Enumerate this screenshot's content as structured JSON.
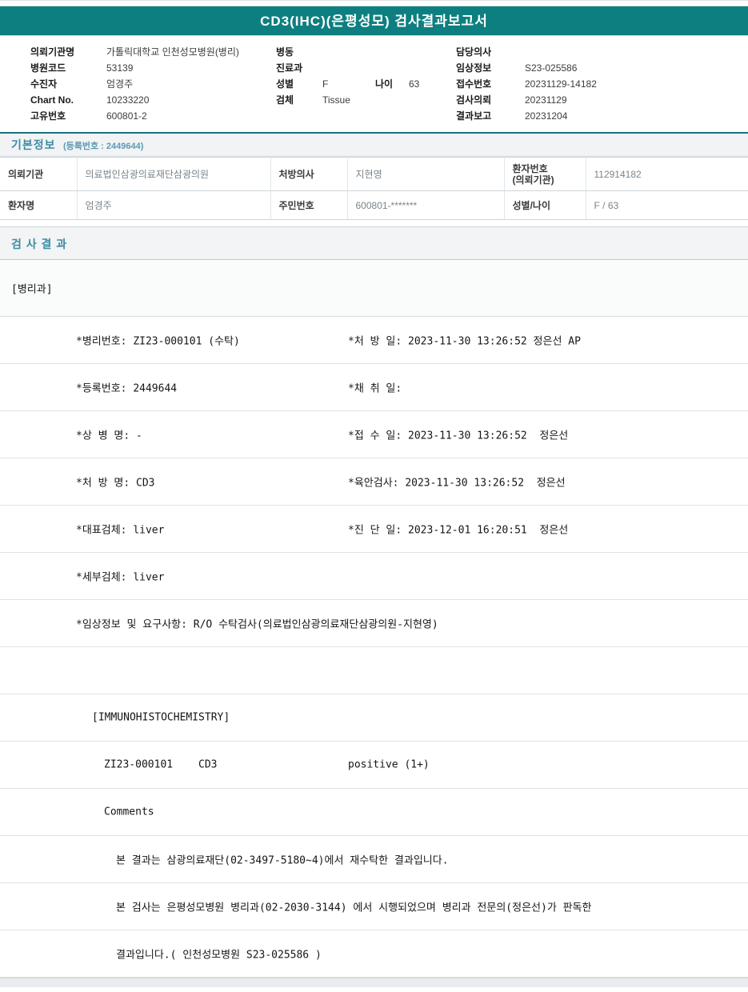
{
  "title": "CD3(IHC)(은평성모) 검사결과보고서",
  "header": {
    "left": [
      {
        "label": "의뢰기관명",
        "value": "가톨릭대학교 인천성모병원(병리)"
      },
      {
        "label": "병원코드",
        "value": "53139"
      },
      {
        "label": "수진자",
        "value": "엄경주"
      },
      {
        "label": "Chart No.",
        "value": "10233220"
      },
      {
        "label": "고유번호",
        "value": "600801-2"
      }
    ],
    "middle": {
      "ward_label": "병동",
      "dept_label": "진료과",
      "sex_label": "성별",
      "sex_value": "F",
      "age_label": "나이",
      "age_value": "63",
      "specimen_label": "검체",
      "specimen_value": "Tissue"
    },
    "right": [
      {
        "label": "담당의사",
        "value": ""
      },
      {
        "label": "임상정보",
        "value": "S23-025586"
      },
      {
        "label": "접수번호",
        "value": "20231129-14182"
      },
      {
        "label": "검사의뢰",
        "value": "20231129"
      },
      {
        "label": "결과보고",
        "value": "20231204"
      }
    ]
  },
  "basic_info": {
    "section_title": "기본정보",
    "section_sub": "(등록번호 : 2449644)",
    "rows": [
      [
        {
          "label": "의뢰기관",
          "value": "의료법인삼광의료재단삼광의원"
        },
        {
          "label": "처방의사",
          "value": "지현영"
        },
        {
          "label": "환자번호\n(의뢰기관)",
          "value": "112914182"
        }
      ],
      [
        {
          "label": "환자명",
          "value": "엄경주"
        },
        {
          "label": "주민번호",
          "value": "600801-*******"
        },
        {
          "label": "성별/나이",
          "value": "F / 63"
        }
      ]
    ]
  },
  "results": {
    "section_title": "검 사 결 과",
    "dept": "[병리과]",
    "detail_rows": [
      {
        "left": "*병리번호: ZI23-000101 (수탁)",
        "right": "*처 방 일: 2023-11-30 13:26:52 정은선 AP"
      },
      {
        "left": "*등록번호: 2449644",
        "right": "*채 취 일:"
      },
      {
        "left": "*상 병 명: -",
        "right": "*접 수 일: 2023-11-30 13:26:52  정은선"
      },
      {
        "left": "*처 방 명: CD3",
        "right": "*육안검사: 2023-11-30 13:26:52  정은선"
      },
      {
        "left": "*대표검체: liver",
        "right": "*진 단 일: 2023-12-01 16:20:51  정은선"
      },
      {
        "left": "*세부검체: liver",
        "right": ""
      },
      {
        "left": "*임상정보 및 요구사항: R/O 수탁검사(의료법인삼광의료재단삼광의원-지현영)",
        "right": ""
      },
      {
        "left": "",
        "right": ""
      }
    ],
    "ihc_header": "[IMMUNOHISTOCHEMISTRY]",
    "ihc_row": {
      "code": "ZI23-000101",
      "test": "CD3",
      "result": "positive (1+)"
    },
    "comments_label": "Comments",
    "comment_lines": [
      "본 결과는 삼광의료재단(02-3497-5180~4)에서 재수탁한 결과입니다.",
      "본 검사는 은평성모병원 병리과(02-2030-3144) 에서 시행되었으며 병리과 전문의(정은선)가 판독한",
      "결과입니다.( 인천성모병원 S23-025586 )"
    ]
  },
  "colors": {
    "teal_header": "#0e7f80",
    "section_text": "#3d8ca6"
  }
}
